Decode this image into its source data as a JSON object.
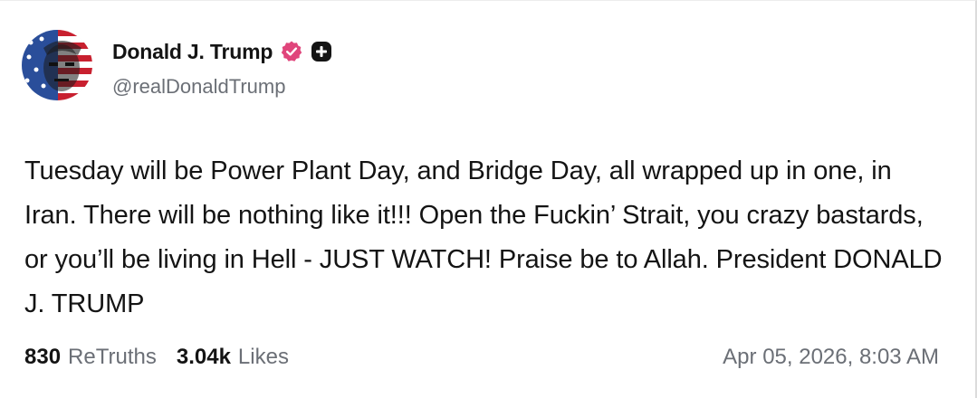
{
  "author": {
    "display_name": "Donald J. Trump",
    "handle": "@realDonaldTrump",
    "verified_icon": "verified-badge-icon",
    "plus_icon": "plus-icon",
    "verified_color": "#e0457b"
  },
  "post": {
    "text": "Tuesday will be Power Plant Day, and Bridge Day, all wrapped up in one, in Iran. There will be nothing like it!!! Open the Fuckin’ Strait, you crazy bastards, or you’ll be living in Hell - JUST WATCH! Praise be to Allah. President DONALD J. TRUMP"
  },
  "stats": {
    "retruths_count": "830",
    "retruths_label": "ReTruths",
    "likes_count": "3.04k",
    "likes_label": "Likes"
  },
  "timestamp": "Apr 05, 2026, 8:03 AM"
}
